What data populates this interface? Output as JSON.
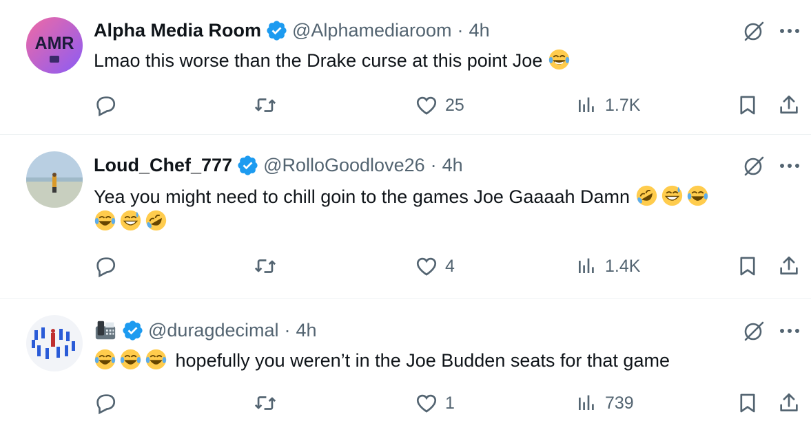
{
  "colors": {
    "text": "#0f1419",
    "secondary": "#536471",
    "verified": "#1d9bf0",
    "divider": "#eff3f4"
  },
  "tweets": [
    {
      "name": "Alpha Media Room",
      "verified": true,
      "handle": "@Alphamediaroom",
      "separator": "·",
      "time": "4h",
      "avatar_icon": "amr-logo-avatar",
      "avatar_text": "AMR",
      "text": "Lmao this worse than the Drake curse at this point Joe",
      "emojis_after": [
        "joy"
      ],
      "replies": "",
      "retweets": "",
      "likes": "25",
      "views": "1.7K"
    },
    {
      "name": "Loud_Chef_777",
      "verified": true,
      "handle": "@RolloGoodlove26",
      "separator": "·",
      "time": "4h",
      "avatar_icon": "beach-photo-avatar",
      "text": "Yea you might need to chill goin to the games Joe Gaaaah Damn",
      "emojis_after": [
        "rofl",
        "sweat-smile",
        "joy"
      ],
      "emojis_line2": [
        "joy",
        "sweat-smile",
        "rofl"
      ],
      "replies": "",
      "retweets": "",
      "likes": "4",
      "views": "1.4K"
    },
    {
      "name": "",
      "name_emoji": "fax-machine",
      "verified": true,
      "handle": "@duragdecimal",
      "separator": "·",
      "time": "4h",
      "avatar_icon": "crowd-figures-avatar",
      "emojis_before": [
        "joy",
        "joy",
        "joy"
      ],
      "text": "hopefully you weren’t in the Joe Budden seats for that game",
      "replies": "",
      "retweets": "",
      "likes": "1",
      "views": "739"
    }
  ]
}
